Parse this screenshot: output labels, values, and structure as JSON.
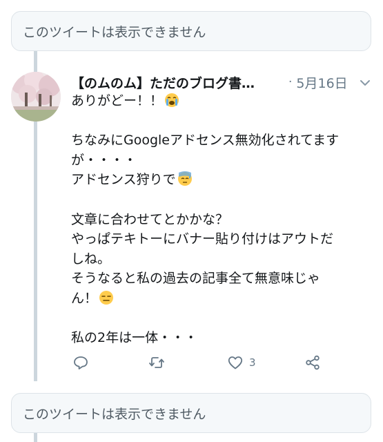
{
  "unavailable_top": {
    "text": "このツイートは表示できません"
  },
  "tweet": {
    "author": "【のムのム】ただのブログ書…",
    "separator": "·",
    "date": "5月16日",
    "lines": [
      "ありがどー！！",
      "",
      "ちなみにGoogleアドセンス無効化されてます",
      "が・・・・",
      "アドセンス狩りで",
      "",
      "文章に合わせてとかかな？",
      "やっぱテキトーにバナー貼り付けはアウトだ",
      "しね。",
      "そうなると私の過去の記事全て無意味じゃ",
      "ん！",
      "",
      "私の2年は一体・・・"
    ],
    "emojis": {
      "line_0": "loudly-crying-face-emoji",
      "line_4": "sweat-sleepy-face-emoji",
      "line_10": "expressionless-face-emoji"
    },
    "actions": {
      "reply_icon": "reply-icon",
      "retweet_icon": "retweet-icon",
      "like_icon": "heart-icon",
      "like_count": "3",
      "share_icon": "share-icon"
    }
  },
  "unavailable_bottom": {
    "text": "このツイートは表示できません"
  },
  "colors": {
    "text": "#14171a",
    "secondary": "#657786",
    "thread_line": "#ccd6dd",
    "card_bg": "#f5f8fa",
    "card_border": "#dde3e8"
  }
}
